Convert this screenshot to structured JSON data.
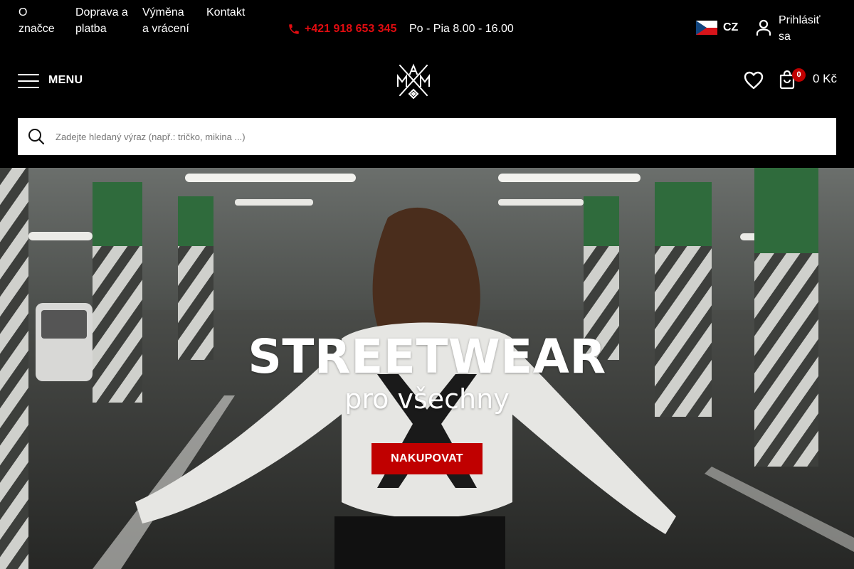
{
  "top_links": [
    {
      "label": "O značce"
    },
    {
      "label": "Doprava a platba"
    },
    {
      "label": "Výměna a vrácení"
    },
    {
      "label": "Kontakt"
    }
  ],
  "contact": {
    "phone": "+421 918 653 345",
    "hours": "Po - Pia 8.00 - 16.00",
    "phone_color": "#e10c10",
    "icon": "phone-icon"
  },
  "language": {
    "code": "CZ",
    "flag": "czech-flag-icon"
  },
  "account": {
    "label": "Prihlásiť sa",
    "icon": "user-icon"
  },
  "header": {
    "menu_label": "MENU",
    "logo_alt": "MAM brand logo",
    "wishlist_icon": "heart-icon",
    "cart": {
      "count": "0",
      "total": "0 Kč",
      "badge_color": "#c00000",
      "icon": "shopping-bag-icon"
    }
  },
  "search": {
    "placeholder": "Zadejte hledaný výraz (např.: tričko, mikina ...)",
    "icon": "search-icon"
  },
  "hero": {
    "title": "STREETWEAR",
    "subtitle": "pro všechny",
    "cta_label": "NAKUPOVAT",
    "cta_color": "#c00000"
  }
}
